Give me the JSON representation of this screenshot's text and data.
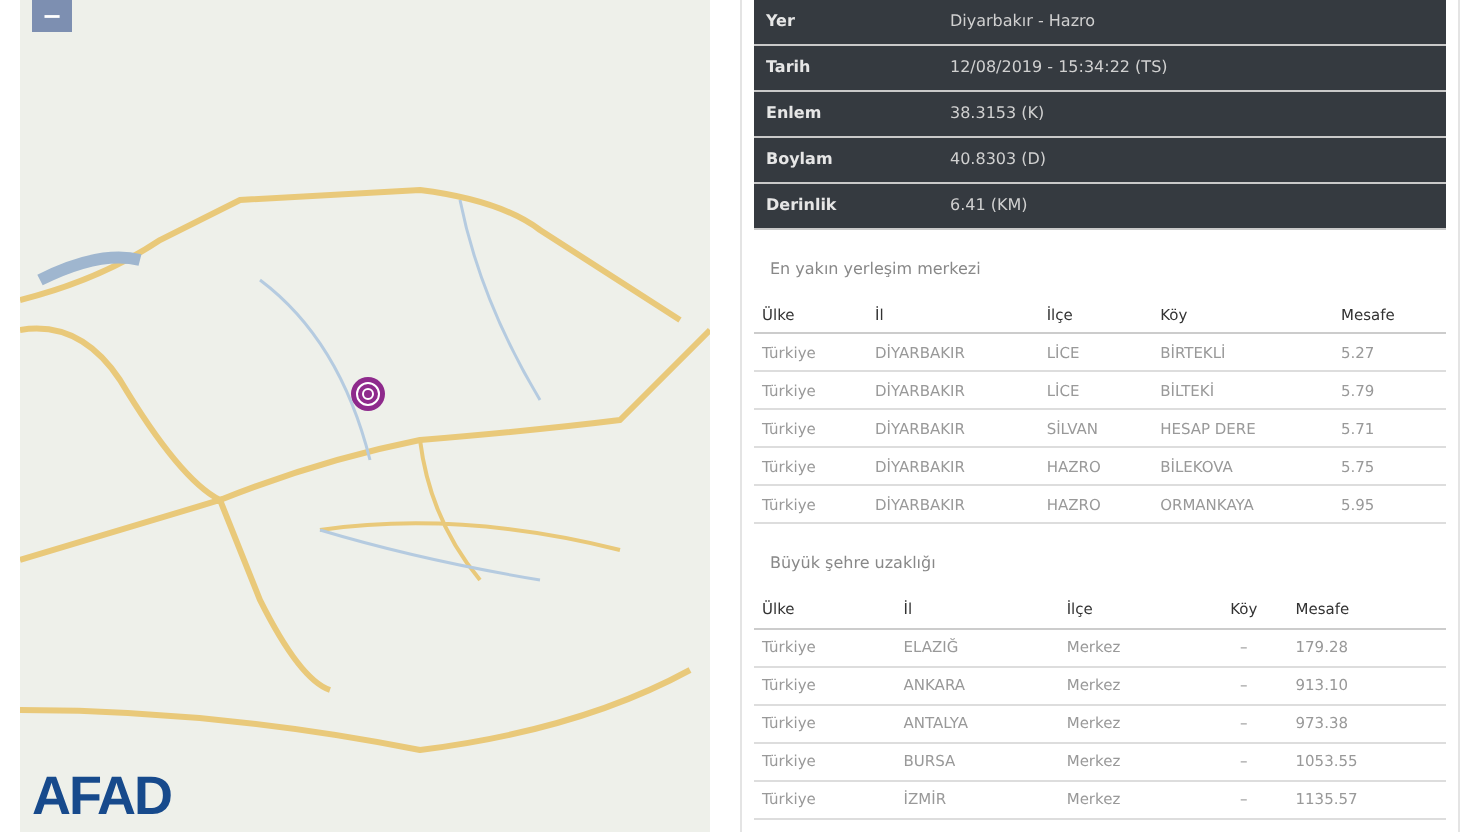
{
  "map": {
    "zoom_out": "−",
    "logo": "AFAD"
  },
  "details": [
    {
      "label": "Yer",
      "value": "Diyarbakır - Hazro"
    },
    {
      "label": "Tarih",
      "value": "12/08/2019 - 15:34:22 (TS)"
    },
    {
      "label": "Enlem",
      "value": "38.3153 (K)"
    },
    {
      "label": "Boylam",
      "value": "40.8303 (D)"
    },
    {
      "label": "Derinlik",
      "value": "6.41 (KM)"
    }
  ],
  "nearest": {
    "title": "En yakın yerleşim merkezi",
    "columns": [
      "Ülke",
      "İl",
      "İlçe",
      "Köy",
      "Mesafe"
    ],
    "rows": [
      [
        "Türkiye",
        "DİYARBAKIR",
        "LİCE",
        "BİRTEKLİ",
        "5.27"
      ],
      [
        "Türkiye",
        "DİYARBAKIR",
        "LİCE",
        "BİLTEKİ",
        "5.79"
      ],
      [
        "Türkiye",
        "DİYARBAKIR",
        "SİLVAN",
        "HESAP DERE",
        "5.71"
      ],
      [
        "Türkiye",
        "DİYARBAKIR",
        "HAZRO",
        "BİLEKOVA",
        "5.75"
      ],
      [
        "Türkiye",
        "DİYARBAKIR",
        "HAZRO",
        "ORMANKAYA",
        "5.95"
      ]
    ]
  },
  "cities": {
    "title": "Büyük şehre uzaklığı",
    "columns": [
      "Ülke",
      "İl",
      "İlçe",
      "Köy",
      "Mesafe"
    ],
    "rows": [
      [
        "Türkiye",
        "ELAZIĞ",
        "Merkez",
        "–",
        "179.28"
      ],
      [
        "Türkiye",
        "ANKARA",
        "Merkez",
        "–",
        "913.10"
      ],
      [
        "Türkiye",
        "ANTALYA",
        "Merkez",
        "–",
        "973.38"
      ],
      [
        "Türkiye",
        "BURSA",
        "Merkez",
        "–",
        "1053.55"
      ],
      [
        "Türkiye",
        "İZMİR",
        "Merkez",
        "–",
        "1135.57"
      ]
    ]
  }
}
